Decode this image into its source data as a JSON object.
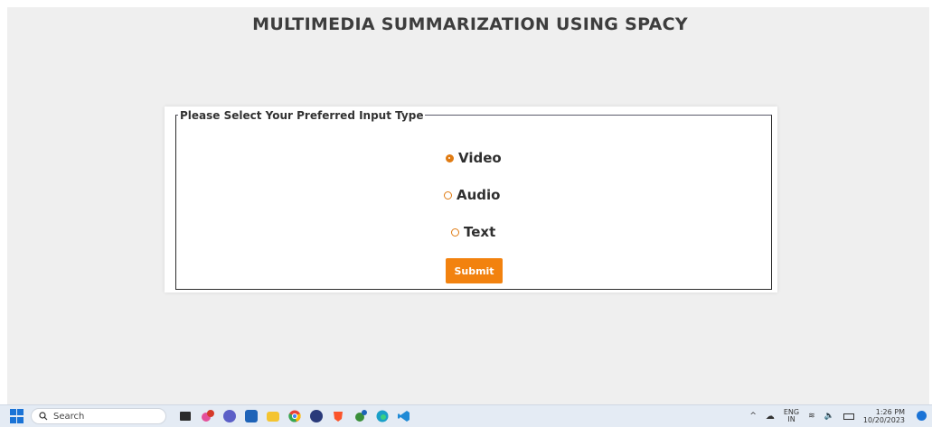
{
  "page": {
    "title": "MULTIMEDIA SUMMARIZATION USING SPACY"
  },
  "form": {
    "legend": "Please Select Your Preferred Input Type",
    "options": [
      {
        "label": "Video",
        "checked": true
      },
      {
        "label": "Audio",
        "checked": false
      },
      {
        "label": "Text",
        "checked": false
      }
    ],
    "submit_label": "Submit",
    "accent_color": "#f2820f"
  },
  "taskbar": {
    "search_placeholder": "Search",
    "apps": [
      "terminal-icon",
      "copilot-icon",
      "chat-icon",
      "store-icon",
      "file-explorer-icon",
      "chrome-icon",
      "app-icon",
      "brave-icon",
      "git-icon",
      "edge-icon",
      "vscode-icon"
    ],
    "language": "ENG",
    "region": "IN",
    "time": "1:26 PM",
    "date": "10/20/2023"
  }
}
